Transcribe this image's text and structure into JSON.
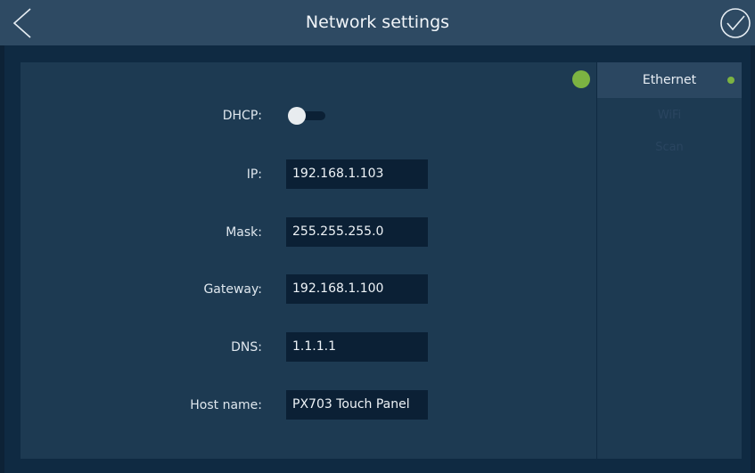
{
  "header": {
    "title": "Network settings",
    "back_icon": "chevron-left-icon",
    "confirm_icon": "check-circle-icon"
  },
  "status": {
    "color": "#7cb342"
  },
  "sidebar": {
    "items": [
      {
        "label": "Ethernet",
        "active": true,
        "indicator_color": "#7cb342"
      },
      {
        "label": "WiFi",
        "active": false
      },
      {
        "label": "Scan",
        "active": false
      }
    ]
  },
  "form": {
    "dhcp": {
      "label": "DHCP:",
      "enabled": false
    },
    "ip": {
      "label": "IP:",
      "value": "192.168.1.103"
    },
    "mask": {
      "label": "Mask:",
      "value": "255.255.255.0"
    },
    "gateway": {
      "label": "Gateway:",
      "value": "192.168.1.100"
    },
    "dns": {
      "label": "DNS:",
      "value": "1.1.1.1"
    },
    "hostname": {
      "label": "Host name:",
      "value": "PX703 Touch Panel"
    }
  }
}
